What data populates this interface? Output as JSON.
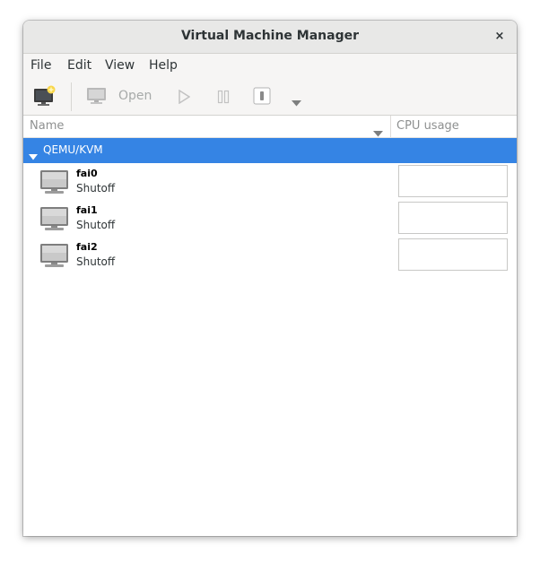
{
  "window": {
    "title": "Virtual Machine Manager",
    "close_icon": "×"
  },
  "menu": {
    "items": [
      "File",
      "Edit",
      "View",
      "Help"
    ]
  },
  "toolbar": {
    "new_vm_icon": "new-vm-icon",
    "open_label": "Open",
    "run_icon": "play-icon",
    "pause_icon": "pause-icon",
    "shutdown_icon": "power-icon",
    "shutdown_menu_icon": "chevron-down-icon"
  },
  "columns": {
    "name": "Name",
    "cpu": "CPU usage"
  },
  "connection": {
    "label": "QEMU/KVM"
  },
  "vms": [
    {
      "name": "fai0",
      "status": "Shutoff"
    },
    {
      "name": "fai1",
      "status": "Shutoff"
    },
    {
      "name": "fai2",
      "status": "Shutoff"
    }
  ],
  "colors": {
    "selection": "#3584e4",
    "header_bg": "#e8e8e7",
    "toolbar_bg": "#f6f5f4"
  }
}
